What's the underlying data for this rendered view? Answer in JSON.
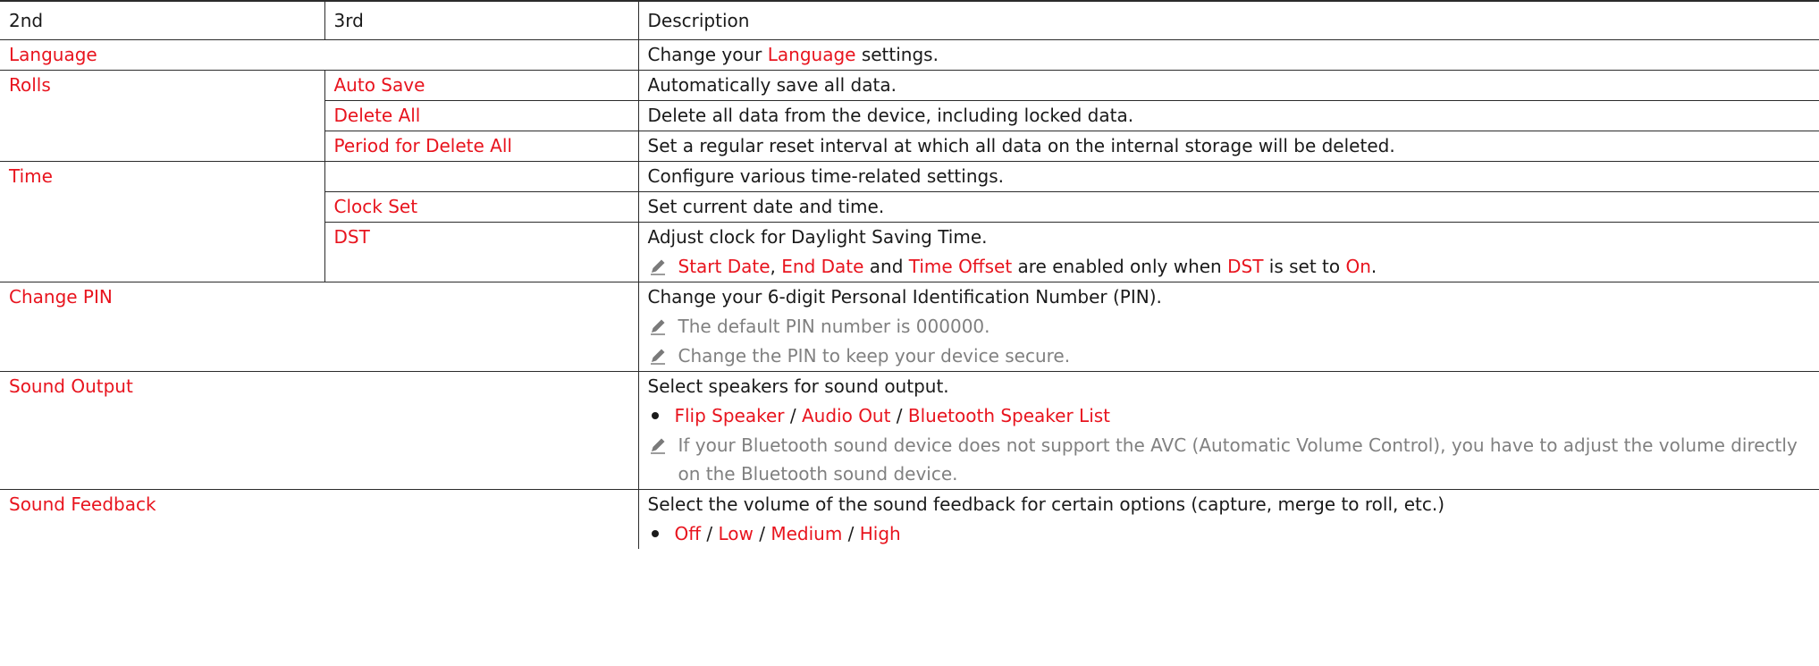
{
  "header": {
    "col1": "2nd",
    "col2": "3rd",
    "col3": "Description"
  },
  "colors": {
    "accent": "#e8141e",
    "note": "#808080",
    "text": "#1a1a1a",
    "border": "#2b2b2b"
  },
  "rows": {
    "language": {
      "name": "Language",
      "desc_pre": "Change your ",
      "desc_link": "Language",
      "desc_post": " settings."
    },
    "rolls": {
      "name": "Rolls",
      "items": [
        {
          "name": "Auto Save",
          "desc": "Automatically save all data."
        },
        {
          "name": "Delete All",
          "desc": "Delete all data from the device, including locked data."
        },
        {
          "name": "Period for Delete All",
          "desc": "Set a regular reset interval at which all data on the internal storage will be deleted."
        }
      ]
    },
    "time": {
      "name": "Time",
      "desc": "Configure various time-related settings.",
      "clock_set": {
        "name": "Clock Set",
        "desc": "Set current date and time."
      },
      "dst": {
        "name": "DST",
        "desc": "Adjust clock for Daylight Saving Time.",
        "note": {
          "t1": "Start Date",
          "s1": ", ",
          "t2": "End Date",
          "s2": " and ",
          "t3": "Time Offset",
          "s3": " are enabled only when ",
          "t4": "DST",
          "s4": " is set to ",
          "t5": "On",
          "s5": "."
        }
      }
    },
    "change_pin": {
      "name": "Change PIN",
      "desc": "Change your 6-digit Personal Identification Number (PIN).",
      "note1": "The default PIN number is 000000.",
      "note2": "Change the PIN to keep your device secure."
    },
    "sound_output": {
      "name": "Sound Output",
      "desc": "Select speakers for sound output.",
      "options": [
        "Flip Speaker",
        "Audio Out",
        "Bluetooth Speaker List"
      ],
      "separator": " / ",
      "note": "If your Bluetooth sound device does not support the AVC (Automatic Volume Control), you have to adjust the volume directly on the Bluetooth sound device."
    },
    "sound_feedback": {
      "name": "Sound Feedback",
      "desc": "Select the volume of the sound feedback for certain options (capture, merge to roll, etc.)",
      "options": [
        "Off",
        "Low",
        "Medium",
        "High"
      ],
      "separator": " / "
    }
  },
  "icons": {
    "note": "pencil-icon",
    "bullet": "bullet-icon"
  }
}
